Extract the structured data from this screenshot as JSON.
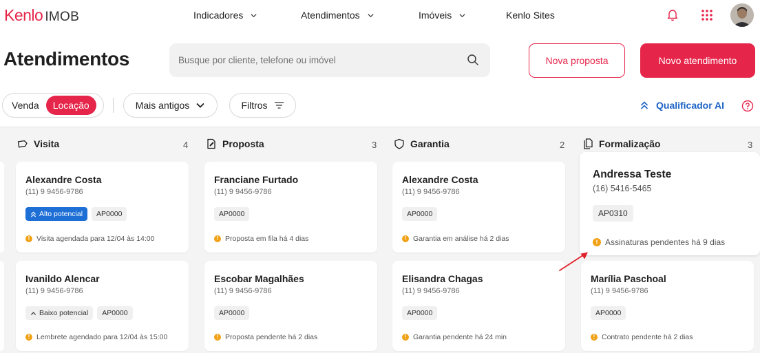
{
  "logo": {
    "brand": "Kenlo",
    "product": "IMOB"
  },
  "nav": {
    "items": [
      "Indicadores",
      "Atendimentos",
      "Imóveis",
      "Kenlo Sites"
    ]
  },
  "header": {
    "title": "Atendimentos",
    "search_placeholder": "Busque por cliente, telefone ou imóvel",
    "btn_nova_proposta": "Nova proposta",
    "btn_novo_atendimento": "Novo atendimento"
  },
  "filters": {
    "toggle": [
      "Venda",
      "Locação"
    ],
    "active_toggle": "Locação",
    "sort": "Mais antigos",
    "filters_label": "Filtros",
    "qualificador": "Qualificador AI"
  },
  "colors": {
    "accent": "#e6254a",
    "blue": "#1d6fd6",
    "warning": "#f1a115"
  },
  "columns": [
    {
      "title": "Visita",
      "count": "4",
      "icon": "tag-icon",
      "cards": [
        {
          "name": "Alexandre Costa",
          "phone": "(11) 9 9456-9786",
          "potential": "Alto potencial",
          "code": "AP0000",
          "status": "Visita agendada para 12/04 às 14:00"
        },
        {
          "name": "Ivanildo Alencar",
          "phone": "(11) 9 9456-9786",
          "potential": "Baixo potencial",
          "code": "AP0000",
          "status": "Lembrete agendado para 12/04 às 15:00"
        }
      ]
    },
    {
      "title": "Proposta",
      "count": "3",
      "icon": "document-edit-icon",
      "cards": [
        {
          "name": "Franciane Furtado",
          "phone": "(11) 9 9456-9786",
          "code": "AP0000",
          "status": "Proposta em fila há 4 dias"
        },
        {
          "name": "Escobar Magalhães",
          "phone": "(11) 9 9456-9786",
          "code": "AP0000",
          "status": "Proposta pendente há 2 dias"
        }
      ]
    },
    {
      "title": "Garantia",
      "count": "2",
      "icon": "shield-icon",
      "cards": [
        {
          "name": "Alexandre Costa",
          "phone": "(11) 9 9456-9786",
          "code": "AP0000",
          "status": "Garantia em análise há 2 dias"
        },
        {
          "name": "Elisandra Chagas",
          "phone": "(11) 9 9456-9786",
          "code": "AP0000",
          "status": "Garantia pendente há 24 min"
        }
      ]
    },
    {
      "title": "Formalização",
      "count": "3",
      "icon": "documents-icon",
      "cards": [
        {
          "name": "Andressa Teste",
          "phone": "(16) 5416-5465",
          "code": "AP0310",
          "status": "Assinaturas pendentes há 9 dias"
        },
        {
          "name": "Marília Paschoal",
          "phone": "(11) 9 9456-9786",
          "code": "AP0000",
          "status": "Contrato pendente há 2 dias"
        }
      ]
    }
  ]
}
